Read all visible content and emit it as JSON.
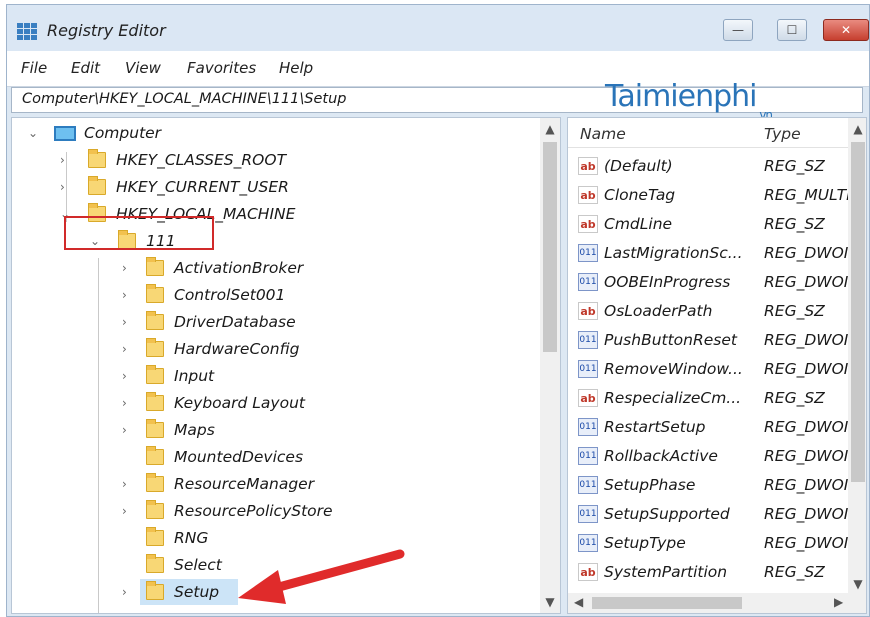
{
  "window": {
    "title": "Registry Editor",
    "buttons": {
      "minimize": "—",
      "maximize": "☐",
      "close": "✕"
    }
  },
  "menu": [
    "File",
    "Edit",
    "View",
    "Favorites",
    "Help"
  ],
  "address": "Computer\\HKEY_LOCAL_MACHINE\\111\\Setup",
  "watermark": {
    "text": "Taimienphi",
    "suffix": ".vn"
  },
  "tree": {
    "root": "Computer",
    "hives": [
      "HKEY_CLASSES_ROOT",
      "HKEY_CURRENT_USER",
      "HKEY_LOCAL_MACHINE"
    ],
    "key_111": "111",
    "children": [
      "ActivationBroker",
      "ControlSet001",
      "DriverDatabase",
      "HardwareConfig",
      "Input",
      "Keyboard Layout",
      "Maps",
      "MountedDevices",
      "ResourceManager",
      "ResourcePolicyStore",
      "RNG",
      "Select",
      "Setup"
    ],
    "selected": "Setup"
  },
  "values_pane": {
    "columns": {
      "name": "Name",
      "type": "Type"
    },
    "rows": [
      {
        "name": "(Default)",
        "type": "REG_SZ",
        "icon": "string-value-icon"
      },
      {
        "name": "CloneTag",
        "type": "REG_MULTI",
        "icon": "string-value-icon"
      },
      {
        "name": "CmdLine",
        "type": "REG_SZ",
        "icon": "string-value-icon"
      },
      {
        "name": "LastMigrationSc...",
        "type": "REG_DWOI",
        "icon": "dword-value-icon"
      },
      {
        "name": "OOBEInProgress",
        "type": "REG_DWOI",
        "icon": "dword-value-icon"
      },
      {
        "name": "OsLoaderPath",
        "type": "REG_SZ",
        "icon": "string-value-icon"
      },
      {
        "name": "PushButtonReset",
        "type": "REG_DWOI",
        "icon": "dword-value-icon"
      },
      {
        "name": "RemoveWindow...",
        "type": "REG_DWOI",
        "icon": "dword-value-icon"
      },
      {
        "name": "RespecializeCm...",
        "type": "REG_SZ",
        "icon": "string-value-icon"
      },
      {
        "name": "RestartSetup",
        "type": "REG_DWOI",
        "icon": "dword-value-icon"
      },
      {
        "name": "RollbackActive",
        "type": "REG_DWOI",
        "icon": "dword-value-icon"
      },
      {
        "name": "SetupPhase",
        "type": "REG_DWOI",
        "icon": "dword-value-icon"
      },
      {
        "name": "SetupSupported",
        "type": "REG_DWOI",
        "icon": "dword-value-icon"
      },
      {
        "name": "SetupType",
        "type": "REG_DWOI",
        "icon": "dword-value-icon"
      },
      {
        "name": "SystemPartition",
        "type": "REG_SZ",
        "icon": "string-value-icon"
      }
    ],
    "icon_glyphs": {
      "string": "ab",
      "dword": "011"
    }
  },
  "colors": {
    "highlight_box": "#d12a2a",
    "arrow": "#e02b2b",
    "selection": "#cce4f7"
  }
}
